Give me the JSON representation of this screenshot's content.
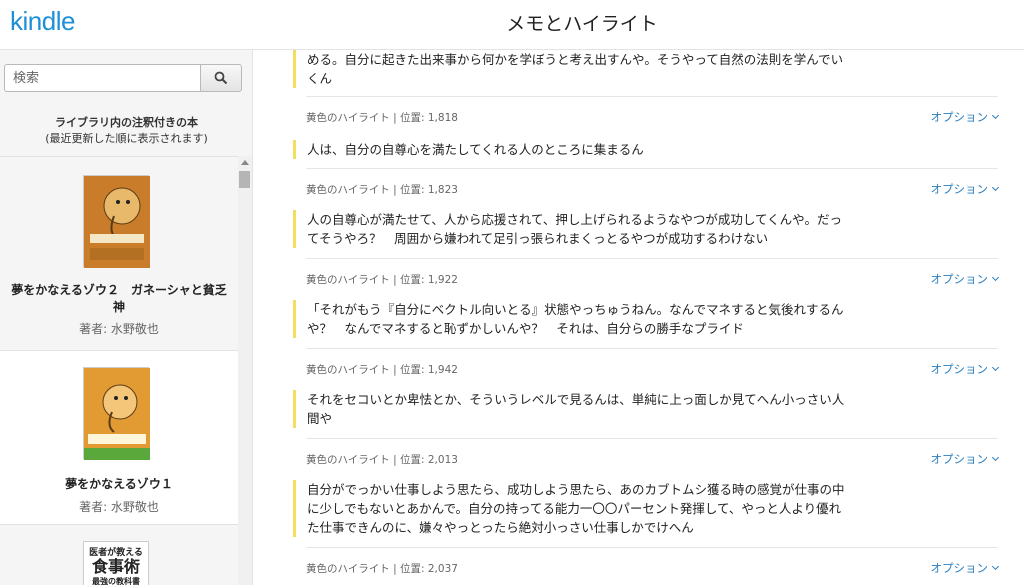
{
  "header": {
    "logo": "kindle",
    "title": "メモとハイライト"
  },
  "sidebar": {
    "search_placeholder": "検索",
    "heading": "ライブラリ内の注釈付きの本",
    "subheading": "(最近更新した順に表示されます)",
    "books": [
      {
        "title_line1": "夢をかなえるゾウ２　ガネーシャと貧乏",
        "title_line2": "神",
        "author": "著者: 水野敬也",
        "cover_label": "「ないもの」は、ひとつもないんだよ。",
        "cover_color": "#d4862a"
      },
      {
        "title_line1": "夢をかなえるゾウ１",
        "author": "著者: 水野敬也",
        "cover_label": "夢をかなえるゾウ",
        "cover_color": "#e29a33"
      },
      {
        "cover_label_top": "医者が教える",
        "cover_label_main": "食事術",
        "cover_label_sub": "最強の教科書"
      }
    ]
  },
  "highlights": [
    {
      "text": "める。自分に起きた出来事から何かを学ぼうと考え出すんや。そうやって自然の法則を学んでいくん",
      "meta": "黄色のハイライト | 位置: 1,818"
    },
    {
      "text": "人は、自分の自尊心を満たしてくれる人のところに集まるん",
      "meta": "黄色のハイライト | 位置: 1,823"
    },
    {
      "text": "人の自尊心が満たせて、人から応援されて、押し上げられるようなやつが成功してくんや。だってそうやろ？　周囲から嫌われて足引っ張られまくっとるやつが成功するわけない",
      "meta": "黄色のハイライト | 位置: 1,922"
    },
    {
      "text": "「それがもう『自分にベクトル向いとる』状態やっちゅうねん。なんでマネすると気後れするんや？　なんでマネすると恥ずかしいんや？　それは、自分らの勝手なプライド",
      "meta": "黄色のハイライト | 位置: 1,942"
    },
    {
      "text": "それをセコいとか卑怯とか、そういうレベルで見るんは、単純に上っ面しか見てへん小っさい人間や",
      "meta": "黄色のハイライト | 位置: 2,013"
    },
    {
      "text": "自分がでっかい仕事しよう思たら、成功しよう思たら、あのカブトムシ獲る時の感覚が仕事の中に少しでもないとあかんで。自分の持ってる能力一〇〇パーセント発揮して、やっと人より優れた仕事できんのに、嫌々やっとったら絶対小っさい仕事しかでけへん",
      "meta": "黄色のハイライト | 位置: 2,037"
    }
  ],
  "option_label": "オプション",
  "colors": {
    "accent": "#1e90d6",
    "highlight_bar": "#f3df5f",
    "link": "#2b7fc0"
  }
}
